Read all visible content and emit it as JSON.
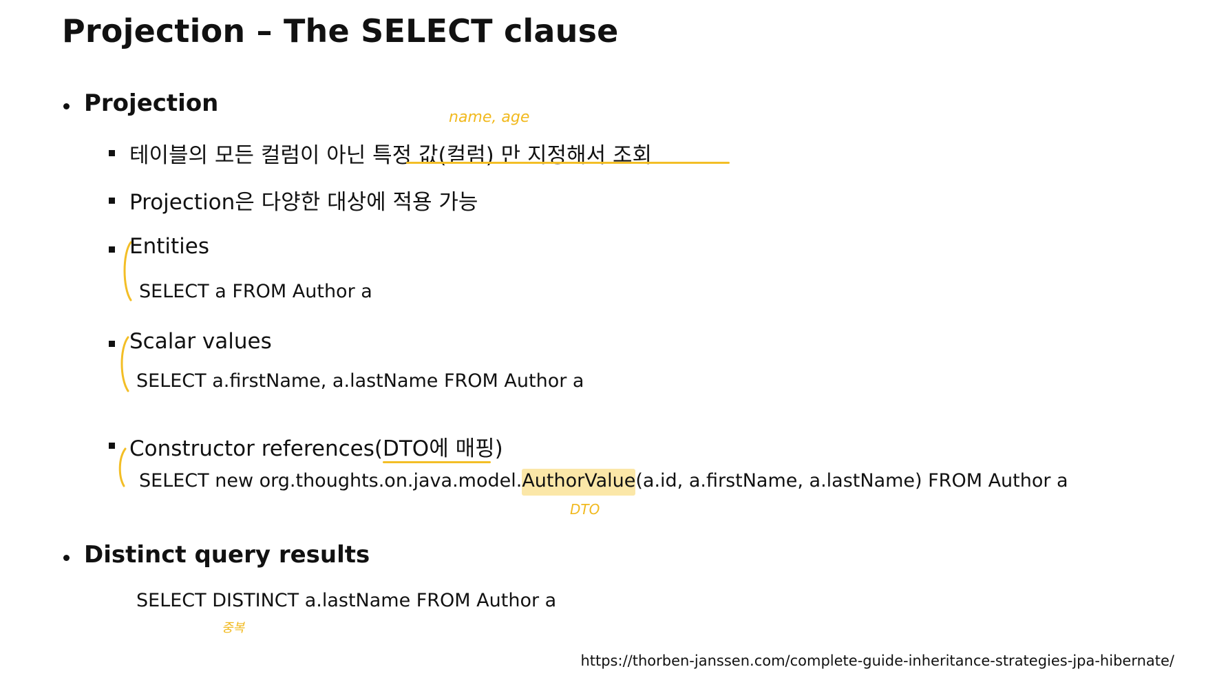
{
  "title": "Projection – The SELECT clause",
  "sections": {
    "projection": {
      "heading": "Projection",
      "note1": "테이블의 모든 컬럼이 아닌 특정 값(컬럼) 만 지정해서 조회",
      "note1_annotation": "name, age",
      "note2": "Projection은 다양한 대상에 적용 가능",
      "entities": {
        "label": "Entities",
        "query": "SELECT a FROM Author a"
      },
      "scalar": {
        "label": "Scalar values",
        "query": "SELECT a.firstName, a.lastName FROM Author a"
      },
      "constructor": {
        "label_prefix": "Constructor references(",
        "label_highlight": "DTO에 매핑",
        "label_suffix": ")",
        "query_prefix": "SELECT new org.thoughts.on.java.model.",
        "query_highlight": "AuthorValue",
        "query_suffix": "(a.id, a.firstName, a.lastName) FROM Author a",
        "annotation": "DTO"
      }
    },
    "distinct": {
      "heading": "Distinct query results",
      "query": "SELECT DISTINCT a.lastName FROM Author a",
      "annotation": "중복"
    }
  },
  "source_url": "https://thorben-janssen.com/complete-guide-inheritance-strategies-jpa-hibernate/",
  "colors": {
    "annotation": "#f3be26",
    "highlight": "#fbe7a8",
    "text": "#111111"
  }
}
